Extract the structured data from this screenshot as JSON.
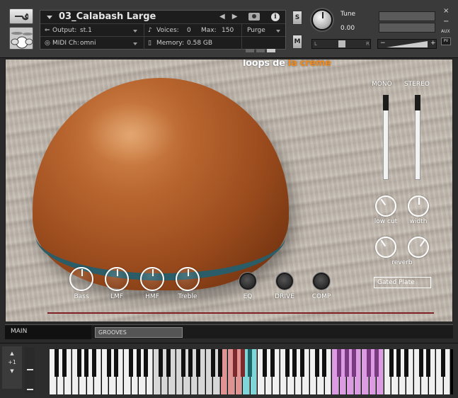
{
  "header": {
    "instrument_name": "03_Calabash Large",
    "output_label": "Output:",
    "output_value": "st.1",
    "voices_label": "Voices:",
    "voices_value": "0",
    "max_label": "Max:",
    "max_value": "150",
    "purge_label": "Purge",
    "midi_label": "MIDI Ch:",
    "midi_value": "omni",
    "memory_label": "Memory:",
    "memory_value": "0.58 GB",
    "solo_label": "S",
    "mute_label": "M",
    "tune_label": "Tune",
    "tune_value": "0.00",
    "pan_left": "L",
    "pan_right": "R",
    "vol_minus": "−",
    "vol_plus": "+",
    "close": "×",
    "minimize": "−",
    "aux_label": "AUX",
    "pv_label": "PV",
    "info_label": "i"
  },
  "panel": {
    "brand_white": "loops de ",
    "brand_orange": "la crème",
    "mono_label": "MONO",
    "stereo_label": "STEREO",
    "low_cut_label": "low cut",
    "width_label": "width",
    "reverb_label": "reverb",
    "reverb_type": "Gated Plate",
    "eq_knobs": [
      "Bass",
      "LMF",
      "HMF",
      "Treble"
    ],
    "fx_buttons": [
      "EQ",
      "DRIVE",
      "COMP"
    ]
  },
  "tabs": {
    "main": "MAIN",
    "grooves": "GROOVES"
  },
  "keyboard": {
    "octave_label": "+1",
    "up_arrow": "▲",
    "down_arrow": "▼",
    "key_colors": {
      "normal": "#f0f0f0",
      "light_gray": "#d7d7d7",
      "red": "#e19292",
      "cyan": "#7fd6d9",
      "pink": "#dc9be3"
    }
  },
  "colors": {
    "brand_orange": "#f18a1c",
    "accent_line": "#7e2024"
  }
}
